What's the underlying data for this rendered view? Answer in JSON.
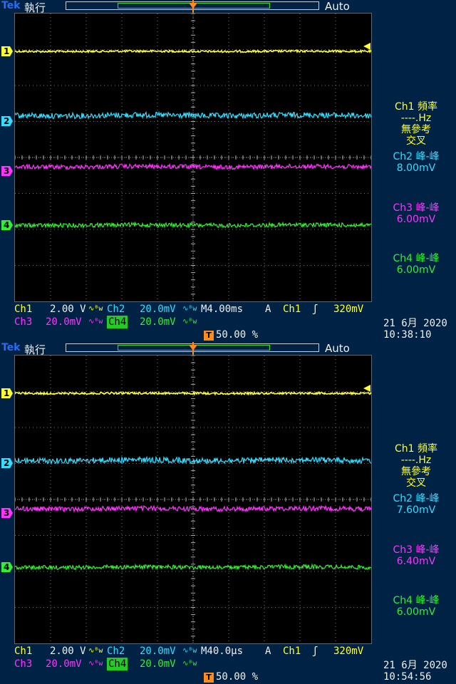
{
  "screens": [
    {
      "header": {
        "brand": "Tek",
        "run_state": "執行",
        "trigger_mode": "Auto"
      },
      "trigger_marker": "T",
      "channels": [
        {
          "label": "1",
          "color": "#ffff33"
        },
        {
          "label": "2",
          "color": "#33ddff"
        },
        {
          "label": "3",
          "color": "#ff33ff"
        },
        {
          "label": "4",
          "color": "#33ee33"
        }
      ],
      "measurements": {
        "ch1": {
          "title": "Ch1 頻率",
          "value": "----.Hz",
          "note1": "無參考",
          "note2": "交叉"
        },
        "ch2": {
          "title": "Ch2 峰-峰",
          "value": "8.00mV"
        },
        "ch3": {
          "title": "Ch3 峰-峰",
          "value": "6.00mV"
        },
        "ch4": {
          "title": "Ch4 峰-峰",
          "value": "6.00mV"
        }
      },
      "settings": {
        "ch1_label": "Ch1",
        "ch1_scale": "2.00 V",
        "ch2_label": "Ch2",
        "ch2_scale": "20.0mV",
        "ch3_label": "Ch3",
        "ch3_scale": "20.0mV",
        "ch4_label": "Ch4",
        "ch4_scale": "20.0mV",
        "bw_symbol": "∿ᴮw",
        "timebase": "M4.00ms",
        "trigger_type": "A",
        "trigger_source": "Ch1",
        "trigger_slope": "ʃ",
        "trigger_level": "320mV",
        "trigger_position": "50.00 %",
        "date": "21 6月  2020",
        "time": "10:38:10"
      }
    },
    {
      "header": {
        "brand": "Tek",
        "run_state": "執行",
        "trigger_mode": "Auto"
      },
      "trigger_marker": "T",
      "channels": [
        {
          "label": "1",
          "color": "#ffff33"
        },
        {
          "label": "2",
          "color": "#33ddff"
        },
        {
          "label": "3",
          "color": "#ff33ff"
        },
        {
          "label": "4",
          "color": "#33ee33"
        }
      ],
      "measurements": {
        "ch1": {
          "title": "Ch1 頻率",
          "value": "----.Hz",
          "note1": "無參考",
          "note2": "交叉"
        },
        "ch2": {
          "title": "Ch2 峰-峰",
          "value": "7.60mV"
        },
        "ch3": {
          "title": "Ch3 峰-峰",
          "value": "6.40mV"
        },
        "ch4": {
          "title": "Ch4 峰-峰",
          "value": "6.00mV"
        }
      },
      "settings": {
        "ch1_label": "Ch1",
        "ch1_scale": "2.00 V",
        "ch2_label": "Ch2",
        "ch2_scale": "20.0mV",
        "ch3_label": "Ch3",
        "ch3_scale": "20.0mV",
        "ch4_label": "Ch4",
        "ch4_scale": "20.0mV",
        "bw_symbol": "∿ᴮw",
        "timebase": "M40.0µs",
        "trigger_type": "A",
        "trigger_source": "Ch1",
        "trigger_slope": "ʃ",
        "trigger_level": "320mV",
        "trigger_position": "50.00 %",
        "date": "21 6月  2020",
        "time": "10:54:56"
      }
    }
  ]
}
